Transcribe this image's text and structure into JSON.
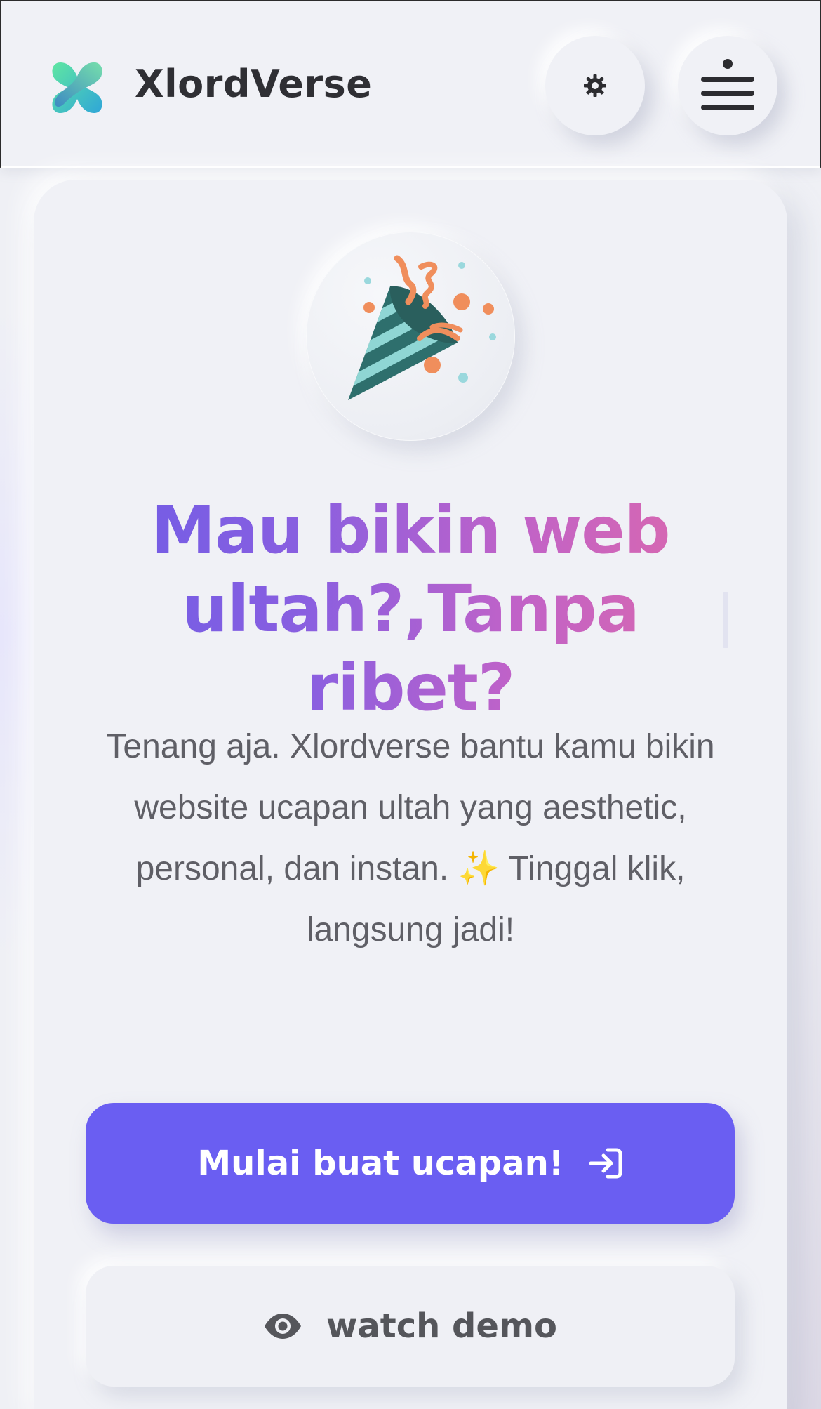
{
  "header": {
    "brand": "XlordVerse",
    "icons": {
      "logo": "xlordverse-logo-icon",
      "theme": "gear-icon",
      "menu": "menu-icon"
    }
  },
  "hero": {
    "illustration": "party-popper-icon",
    "title": "Mau bikin web ultah?,Tanpa ribet?",
    "description": "Tenang aja. Xlordverse bantu kamu bikin website ucapan ultah yang aesthetic, personal, dan instan. ✨ Tinggal klik, langsung jadi!",
    "cta_label": "Mulai buat ucapan!",
    "cta_icon": "login-arrow-icon",
    "demo_label": "watch demo",
    "demo_icon": "eye-icon"
  },
  "colors": {
    "primary": "#6a5ef2",
    "title_gradient_start": "#6c5ce7",
    "title_gradient_end": "#e06aa8",
    "background": "#eff0f5"
  }
}
